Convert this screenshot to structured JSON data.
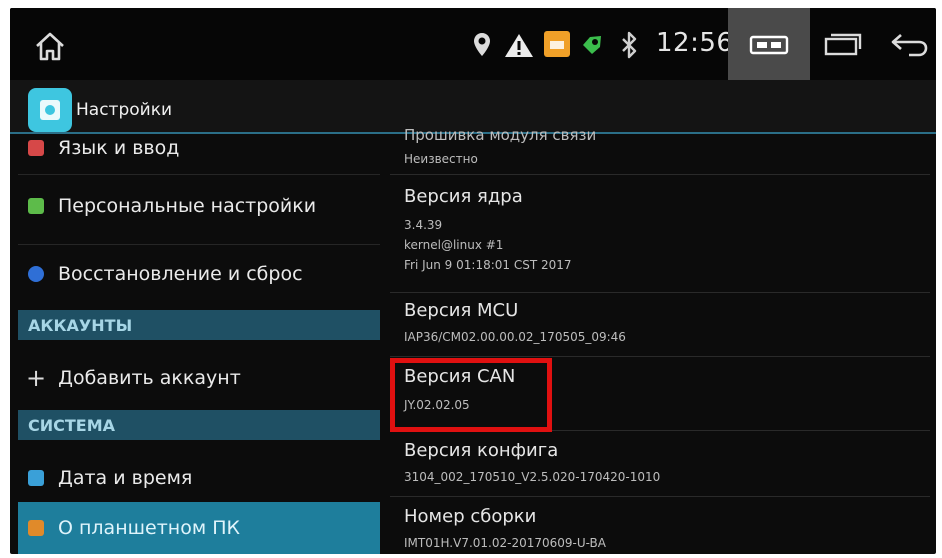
{
  "status_bar": {
    "time": "12:56",
    "icons": [
      "home-icon",
      "location-icon",
      "warning-icon",
      "notification-orange-icon",
      "notification-green-icon",
      "bluetooth-icon",
      "media-icon",
      "recents-icon",
      "back-icon"
    ]
  },
  "action_bar": {
    "title": "Настройки",
    "icon": "settings-app-icon",
    "accent": "#3ec6e0"
  },
  "sidebar": {
    "items": [
      {
        "label": "Язык и ввод",
        "icon": "language-icon",
        "color": "#d64848"
      },
      {
        "label": "Персональные настройки",
        "icon": "personal-icon",
        "color": "#5dbb4a"
      },
      {
        "label": "Восстановление и сброс",
        "icon": "restore-icon",
        "color": "#2f6fd6"
      }
    ],
    "accounts_header": "АККАУНТЫ",
    "add_account": "Добавить аккаунт",
    "system_header": "СИСТЕМА",
    "system_items": [
      {
        "label": "Дата и время",
        "icon": "clock-icon",
        "color": "#3aa0d8"
      },
      {
        "label": "О планшетном ПК",
        "icon": "info-icon",
        "color": "#e08a2a",
        "selected": true
      }
    ],
    "selected_color": "#1e7e9c",
    "header_color": "#1f5064"
  },
  "details": {
    "top_partial_title": "Прошивка модуля связи",
    "top_partial_value": "Неизвестно",
    "kernel": {
      "title": "Версия ядра",
      "lines": [
        "3.4.39",
        "kernel@linux #1",
        "Fri Jun 9 01:18:01 CST 2017"
      ]
    },
    "mcu": {
      "title": "Версия MCU",
      "value": "IAP36/CM02.00.00.02_170505_09:46"
    },
    "can": {
      "title": "Версия CAN",
      "value": "JY.02.02.05"
    },
    "config": {
      "title": "Версия конфига",
      "value": "3104_002_170510_V2.5.020-170420-1010"
    },
    "build": {
      "title": "Номер сборки",
      "value": "IMT01H.V7.01.02-20170609-U-BA"
    }
  },
  "highlight_color": "#e01010"
}
